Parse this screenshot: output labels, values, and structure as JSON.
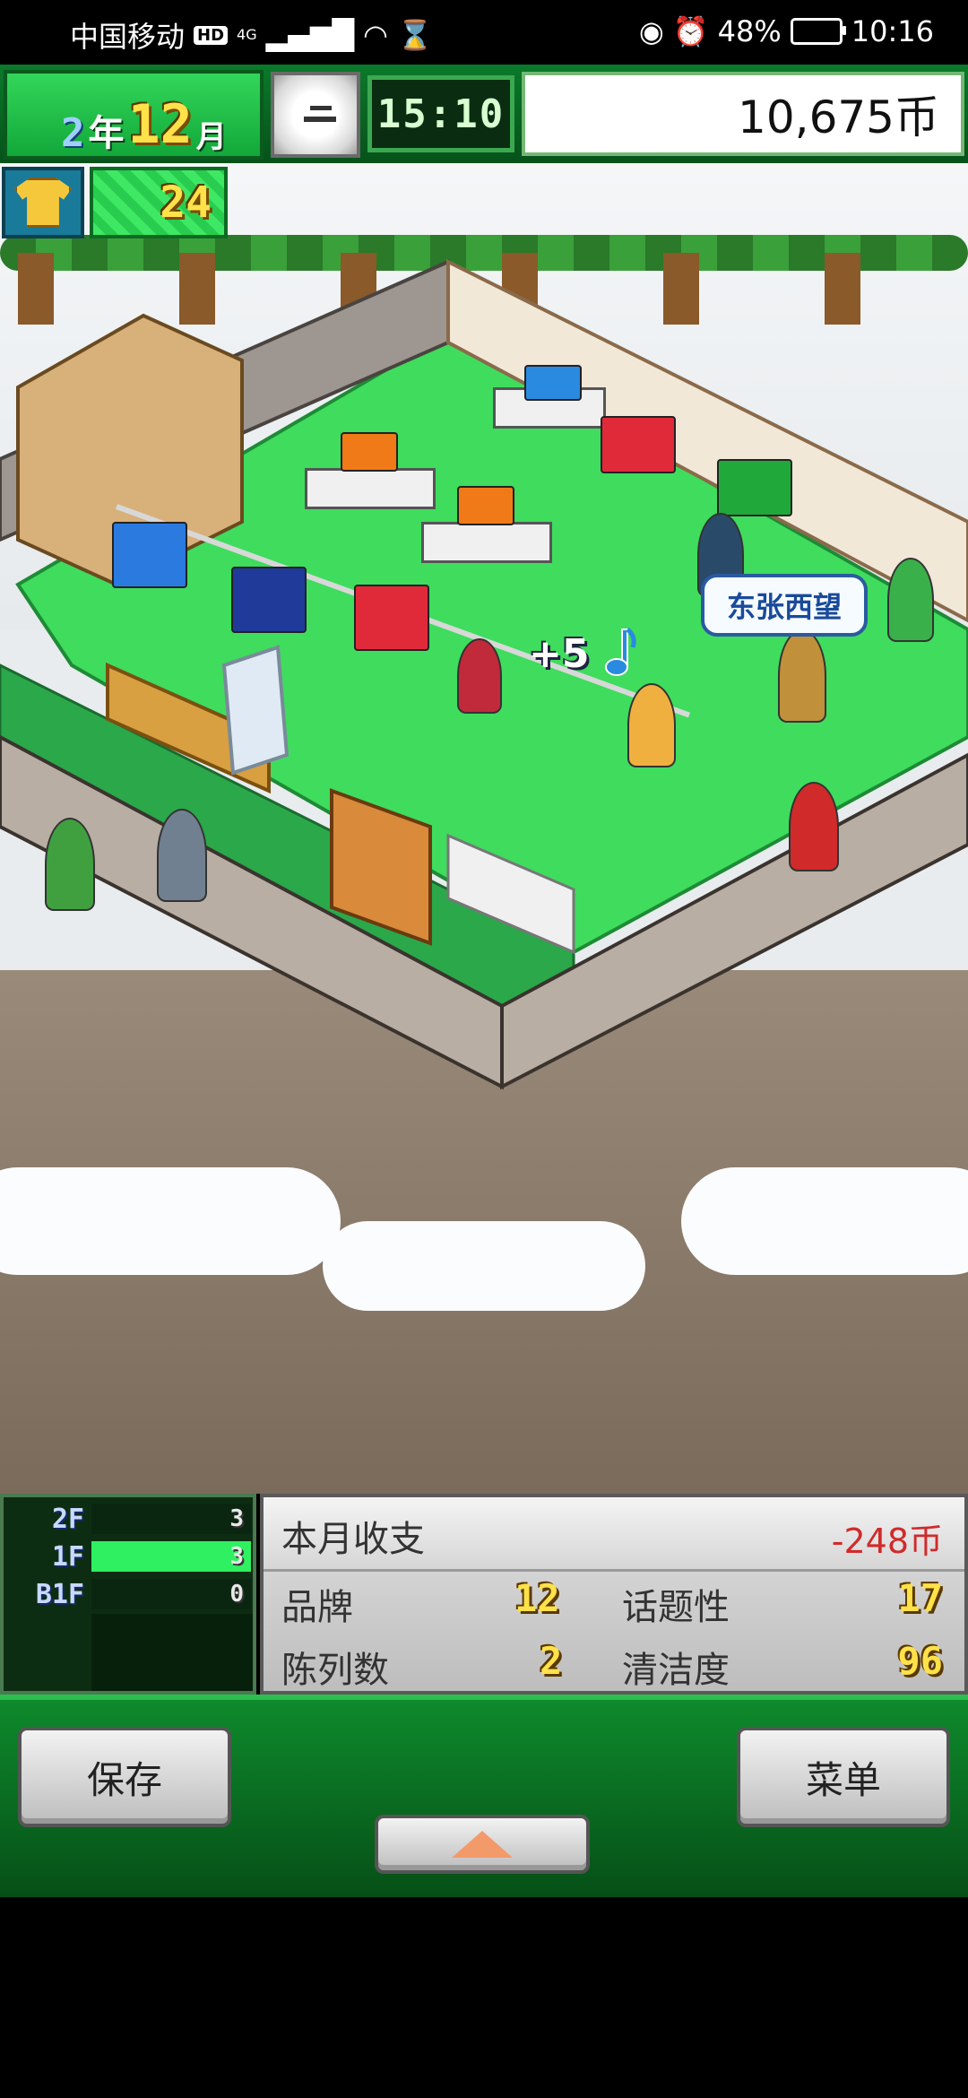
{
  "status_bar": {
    "carrier": "中国移动",
    "hd_badge": "HD",
    "network": "4G",
    "battery": "48%",
    "time": "10:16"
  },
  "hud": {
    "year_number": "2",
    "year_unit": "年",
    "month_number": "12",
    "month_unit": "月",
    "game_time": "15:10",
    "money": "10,675币",
    "rank_value": "24"
  },
  "scene": {
    "speech_bubble": "东张西望",
    "popup_gain": "+5"
  },
  "floors": [
    {
      "label": "2F",
      "count": "3",
      "active": false
    },
    {
      "label": "1F",
      "count": "3",
      "active": true
    },
    {
      "label": "B1F",
      "count": "0",
      "active": false
    }
  ],
  "stats": {
    "monthly_label": "本月收支",
    "monthly_value": "-248币",
    "brand_label": "品牌",
    "brand_value": "12",
    "topic_label": "话题性",
    "topic_value": "17",
    "display_label": "陈列数",
    "display_value": "2",
    "clean_label": "清洁度",
    "clean_value": "96"
  },
  "controls": {
    "save_label": "保存",
    "menu_label": "菜单"
  },
  "colors": {
    "hud_green": "#12a83a",
    "floor_green": "#2ef060",
    "stat_yellow": "#ffe14a",
    "expense_red": "#d12a2a",
    "bubble_blue": "#1a4a9a"
  }
}
